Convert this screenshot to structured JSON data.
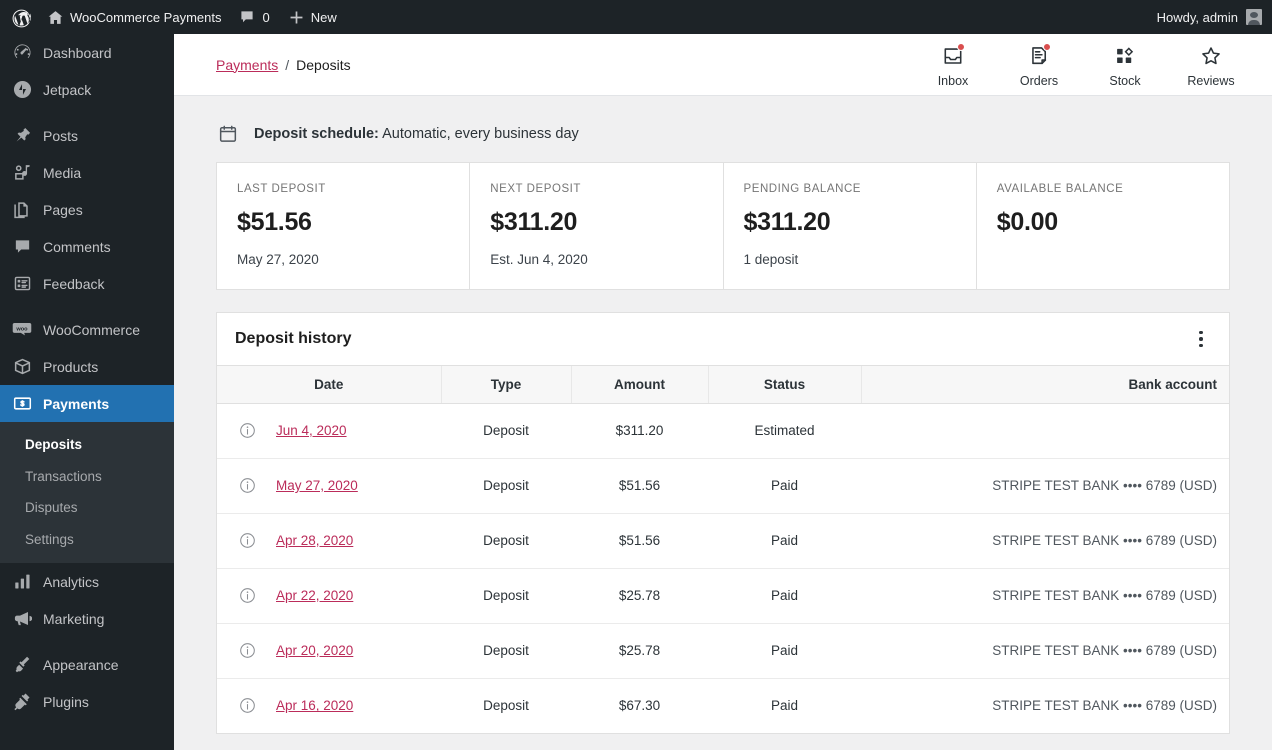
{
  "adminbar": {
    "logo_icon": "wordpress-icon",
    "home_icon": "home-icon",
    "site_name": "WooCommerce Payments",
    "comments_icon": "comment-icon",
    "comments_count": "0",
    "new_icon": "plus-icon",
    "new_label": "New",
    "howdy": "Howdy, admin",
    "avatar_icon": "avatar-icon"
  },
  "sidebar": {
    "items": [
      {
        "label": "Dashboard",
        "icon": "dashboard-icon",
        "sep_after": false
      },
      {
        "label": "Jetpack",
        "icon": "jetpack-icon",
        "sep_after": true
      },
      {
        "label": "Posts",
        "icon": "pin-icon",
        "sep_after": false
      },
      {
        "label": "Media",
        "icon": "media-icon",
        "sep_after": false
      },
      {
        "label": "Pages",
        "icon": "pages-icon",
        "sep_after": false
      },
      {
        "label": "Comments",
        "icon": "comment-icon",
        "sep_after": false
      },
      {
        "label": "Feedback",
        "icon": "feedback-icon",
        "sep_after": true
      },
      {
        "label": "WooCommerce",
        "icon": "woocommerce-icon",
        "sep_after": false
      },
      {
        "label": "Products",
        "icon": "products-icon",
        "sep_after": false
      },
      {
        "label": "Payments",
        "icon": "payments-icon",
        "sep_after": false,
        "current": true
      },
      {
        "label": "Analytics",
        "icon": "analytics-icon",
        "sep_after": false
      },
      {
        "label": "Marketing",
        "icon": "marketing-icon",
        "sep_after": true
      },
      {
        "label": "Appearance",
        "icon": "appearance-icon",
        "sep_after": false
      },
      {
        "label": "Plugins",
        "icon": "plugins-icon",
        "sep_after": false
      }
    ],
    "submenu": [
      {
        "label": "Deposits",
        "current": true
      },
      {
        "label": "Transactions",
        "current": false
      },
      {
        "label": "Disputes",
        "current": false
      },
      {
        "label": "Settings",
        "current": false
      }
    ],
    "highlight_color": "#2271b1"
  },
  "topbar": {
    "breadcrumb": {
      "parent": "Payments",
      "separator": "/",
      "current": "Deposits"
    },
    "actions": [
      {
        "label": "Inbox",
        "icon": "inbox-icon",
        "badge": true
      },
      {
        "label": "Orders",
        "icon": "orders-icon",
        "badge": true
      },
      {
        "label": "Stock",
        "icon": "stock-icon",
        "badge": false
      },
      {
        "label": "Reviews",
        "icon": "star-icon",
        "badge": false
      }
    ],
    "badge_color": "#d94f4f"
  },
  "content": {
    "schedule": {
      "icon": "calendar-icon",
      "label": "Deposit schedule:",
      "value": "Automatic, every business day"
    },
    "cards": [
      {
        "label": "LAST DEPOSIT",
        "value": "$51.56",
        "sub": "May 27, 2020"
      },
      {
        "label": "NEXT DEPOSIT",
        "value": "$311.20",
        "sub": "Est. Jun 4, 2020"
      },
      {
        "label": "PENDING BALANCE",
        "value": "$311.20",
        "sub": "1 deposit"
      },
      {
        "label": "AVAILABLE BALANCE",
        "value": "$0.00",
        "sub": ""
      }
    ],
    "history": {
      "title": "Deposit history",
      "menu_icon": "kebab-menu-icon",
      "columns": [
        "Date",
        "Type",
        "Amount",
        "Status",
        "Bank account"
      ],
      "rows": [
        {
          "info_icon": "info-icon",
          "date": "Jun 4, 2020",
          "type": "Deposit",
          "amount": "$311.20",
          "status": "Estimated",
          "bank": ""
        },
        {
          "info_icon": "info-icon",
          "date": "May 27, 2020",
          "type": "Deposit",
          "amount": "$51.56",
          "status": "Paid",
          "bank": "STRIPE TEST BANK •••• 6789 (USD)"
        },
        {
          "info_icon": "info-icon",
          "date": "Apr 28, 2020",
          "type": "Deposit",
          "amount": "$51.56",
          "status": "Paid",
          "bank": "STRIPE TEST BANK •••• 6789 (USD)"
        },
        {
          "info_icon": "info-icon",
          "date": "Apr 22, 2020",
          "type": "Deposit",
          "amount": "$25.78",
          "status": "Paid",
          "bank": "STRIPE TEST BANK •••• 6789 (USD)"
        },
        {
          "info_icon": "info-icon",
          "date": "Apr 20, 2020",
          "type": "Deposit",
          "amount": "$25.78",
          "status": "Paid",
          "bank": "STRIPE TEST BANK •••• 6789 (USD)"
        },
        {
          "info_icon": "info-icon",
          "date": "Apr 16, 2020",
          "type": "Deposit",
          "amount": "$67.30",
          "status": "Paid",
          "bank": "STRIPE TEST BANK •••• 6789 (USD)"
        }
      ]
    },
    "link_color": "#bb2c5a"
  }
}
